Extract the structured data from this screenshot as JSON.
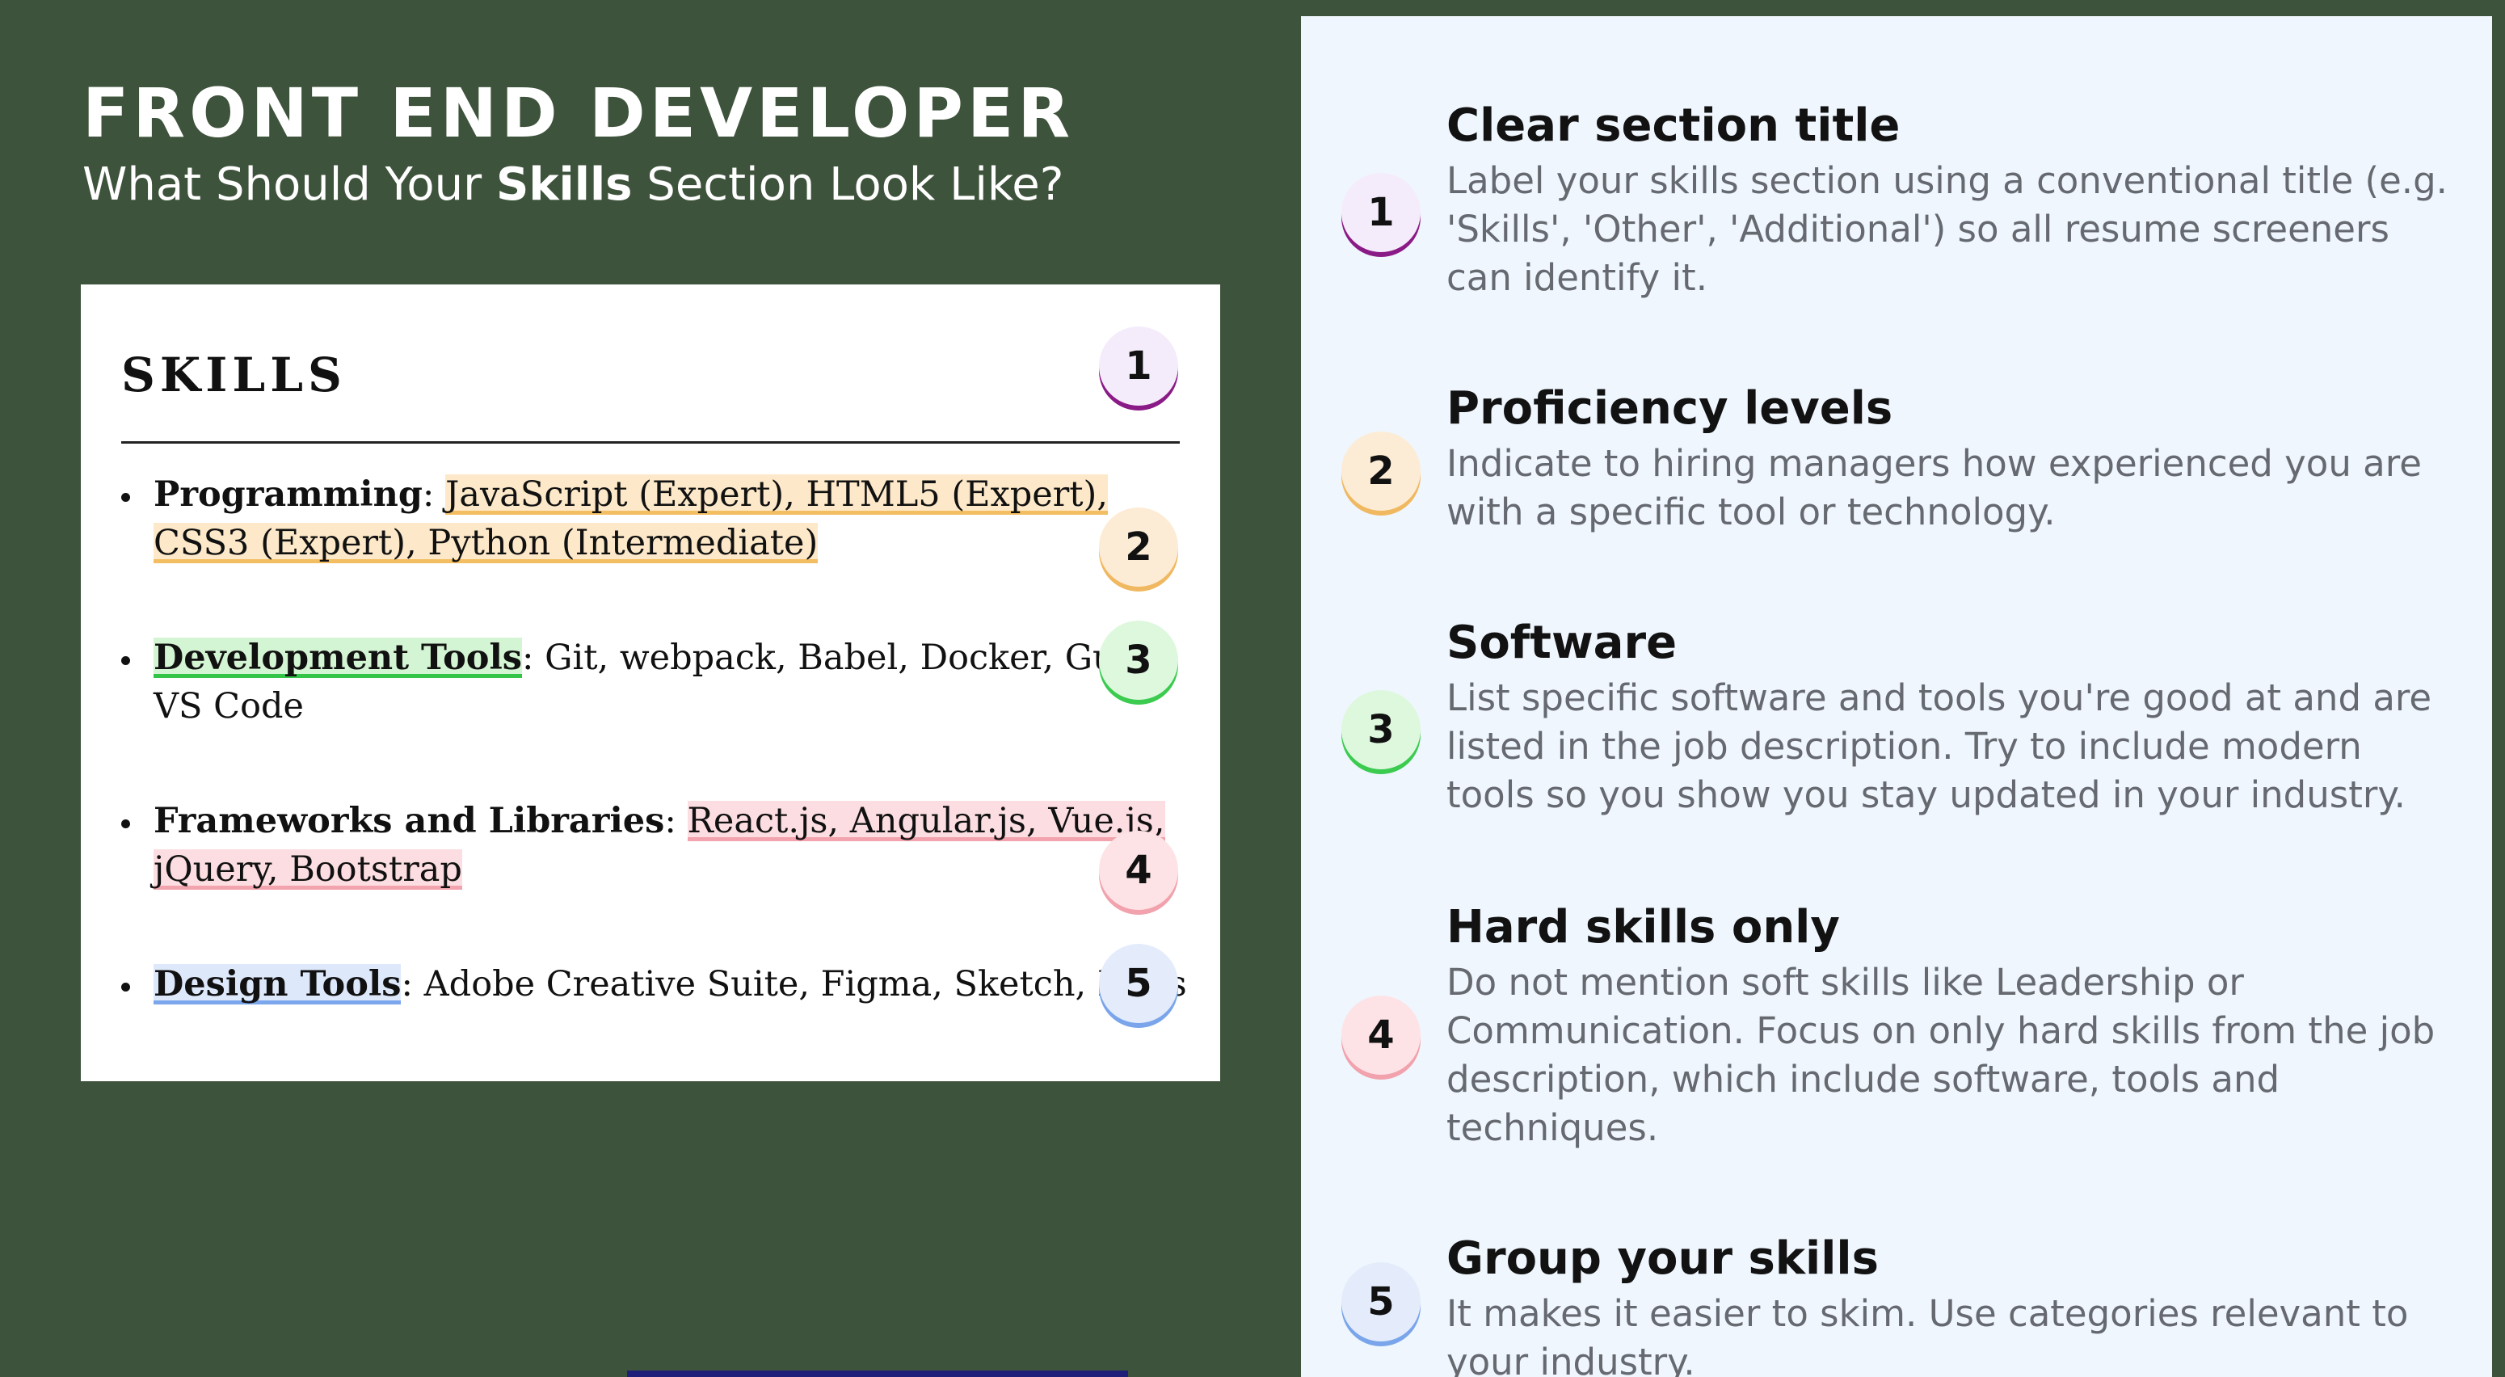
{
  "header": {
    "title": "FRONT END DEVELOPER",
    "subtitle_before": "What Should Your ",
    "subtitle_bold": "Skills",
    "subtitle_after": " Section Look Like?"
  },
  "resume": {
    "heading": "SKILLS",
    "badge_numbers": [
      "1",
      "2",
      "3",
      "4",
      "5"
    ],
    "skills": [
      {
        "category": "Programming",
        "separator": ": ",
        "items": "JavaScript (Expert), HTML5 (Expert), CSS3 (Expert), Python (Intermediate)"
      },
      {
        "category": "Development Tools",
        "separator": ": ",
        "items": "Git, webpack, Babel, Docker, Gulp, VS Code"
      },
      {
        "category": "Frameworks and Libraries",
        "separator": ": ",
        "items": "React.js, Angular.js, Vue.js, jQuery, Bootstrap"
      },
      {
        "category": "Design Tools",
        "separator": ": ",
        "items": "Adobe Creative Suite, Figma, Sketch, InVision"
      }
    ]
  },
  "tips": [
    {
      "number": "1",
      "title": "Clear section title",
      "description": "Label your skills section using a conventional title (e.g. 'Skills', 'Other', 'Additional') so all resume screeners can identify it."
    },
    {
      "number": "2",
      "title": "Proficiency levels",
      "description": "Indicate to hiring managers how experienced you are with a specific tool or technology."
    },
    {
      "number": "3",
      "title": "Software",
      "description": "List specific software and tools you're good at and are listed in the job description. Try to include modern tools so you show you stay updated in your industry."
    },
    {
      "number": "4",
      "title": "Hard skills only",
      "description": "Do not mention soft skills like Leadership or Communication. Focus on only hard skills from the job description, which include software, tools and techniques."
    },
    {
      "number": "5",
      "title": "Group your skills",
      "description": "It makes it easier to skim. Use categories relevant to your industry."
    }
  ],
  "colors": {
    "background": "#3e533b",
    "panel": "#eff6fd",
    "badge_1": "#8a1a86",
    "badge_2": "#f0b860",
    "badge_3": "#3acb4f",
    "badge_4": "#f1a2ac",
    "badge_5": "#7aa5ea"
  }
}
